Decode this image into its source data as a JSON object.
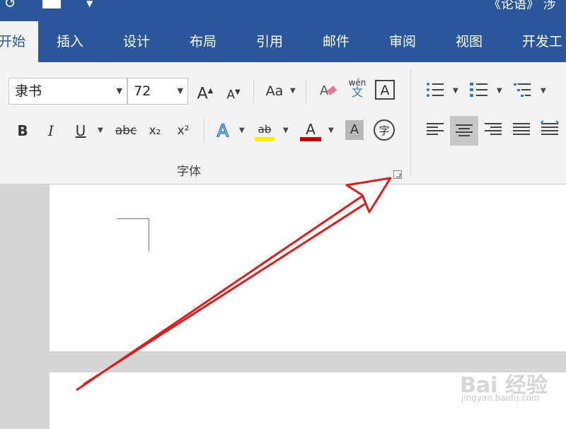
{
  "titlebar": {
    "doc_title": "《论语》 涉"
  },
  "tabs": [
    {
      "label": "开始"
    },
    {
      "label": "插入"
    },
    {
      "label": "设计"
    },
    {
      "label": "布局"
    },
    {
      "label": "引用"
    },
    {
      "label": "邮件"
    },
    {
      "label": "审阅"
    },
    {
      "label": "视图"
    },
    {
      "label": "开发工"
    }
  ],
  "font": {
    "name": "隶书",
    "size": "72",
    "grow_label": "A",
    "shrink_label": "A",
    "case_label": "Aa",
    "phonetic_label": "wén",
    "border_label": "A",
    "bold_label": "B",
    "italic_label": "I",
    "underline_label": "U",
    "strike_label": "abc",
    "subscript_label": "x₂",
    "superscript_label": "x²",
    "effects_label": "A",
    "highlight_label": "ab",
    "color_label": "A",
    "shading_label": "A",
    "enclose_label": "字",
    "group_label": "字体"
  },
  "colors": {
    "accent": "#2b579a",
    "highlight": "#ffee00",
    "font_color": "#c00000",
    "annotation": "#d42020"
  },
  "watermark": {
    "text": "Bai 经验",
    "sub": "jingyan.baidu.com"
  }
}
